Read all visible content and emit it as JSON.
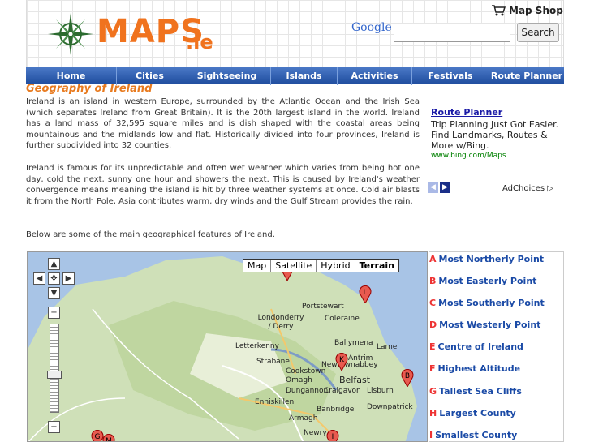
{
  "header": {
    "logo_main": "MAPS",
    "logo_suffix": ".ie",
    "map_shop_label": "Map Shop",
    "google_label": "Google",
    "search_placeholder": "",
    "search_button": "Search"
  },
  "nav": {
    "items": [
      "Home",
      "Cities",
      "Sightseeing",
      "Islands",
      "Activities",
      "Festivals",
      "Route Planner"
    ]
  },
  "content": {
    "title": "Geography of Ireland",
    "para1": "Ireland is an island in western Europe, surrounded by the Atlantic Ocean and the Irish Sea (which separates Ireland from Great Britain). It is the 20th largest island in the world. Ireland has a land mass of 32,595 square miles and is dish shaped with the coastal areas being mountainous and the midlands low and flat. Historically divided into four provinces, Ireland is further subdivided into 32 counties.",
    "para2": "Ireland is famous for its unpredictable and often wet weather which varies from being hot one day, cold the next, sunny one hour and showers the next. This is caused by Ireland's weather convergence means meaning the island is hit by three weather systems at once. Cold air blasts it from the North Pole, Asia contributes warm, dry winds and the Gulf Stream provides the rain.",
    "para3": "Below are some of the main geographical features of Ireland."
  },
  "ad": {
    "title": "Route Planner",
    "body": "Trip Planning Just Got Easier. Find Landmarks, Routes & More w/Bing.",
    "url": "www.bing.com/Maps",
    "adchoices": "AdChoices"
  },
  "map": {
    "types": [
      "Map",
      "Satellite",
      "Hybrid",
      "Terrain"
    ],
    "selected_type": "Terrain",
    "places": [
      "Portstewart",
      "Coleraine",
      "Londonderry / Derry",
      "Letterkenny",
      "Ballymena",
      "Larne",
      "Antrim",
      "Newtownabbey",
      "Belfast",
      "Lisburn",
      "Craigavon",
      "Banbridge",
      "Downpatrick",
      "Strabane",
      "Omagh",
      "Cookstown",
      "Dungannon",
      "Enniskillen",
      "Armagh",
      "Newry"
    ],
    "pins": [
      "L",
      "K",
      "B",
      "I",
      "G",
      "M"
    ]
  },
  "legend": [
    {
      "letter": "A",
      "label": "Most Northerly Point"
    },
    {
      "letter": "B",
      "label": "Most Easterly Point"
    },
    {
      "letter": "C",
      "label": "Most Southerly Point"
    },
    {
      "letter": "D",
      "label": "Most Westerly Point"
    },
    {
      "letter": "E",
      "label": "Centre of Ireland"
    },
    {
      "letter": "F",
      "label": "Highest Altitude"
    },
    {
      "letter": "G",
      "label": "Tallest Sea Cliffs"
    },
    {
      "letter": "H",
      "label": "Largest County"
    },
    {
      "letter": "I",
      "label": "Smallest County"
    }
  ]
}
